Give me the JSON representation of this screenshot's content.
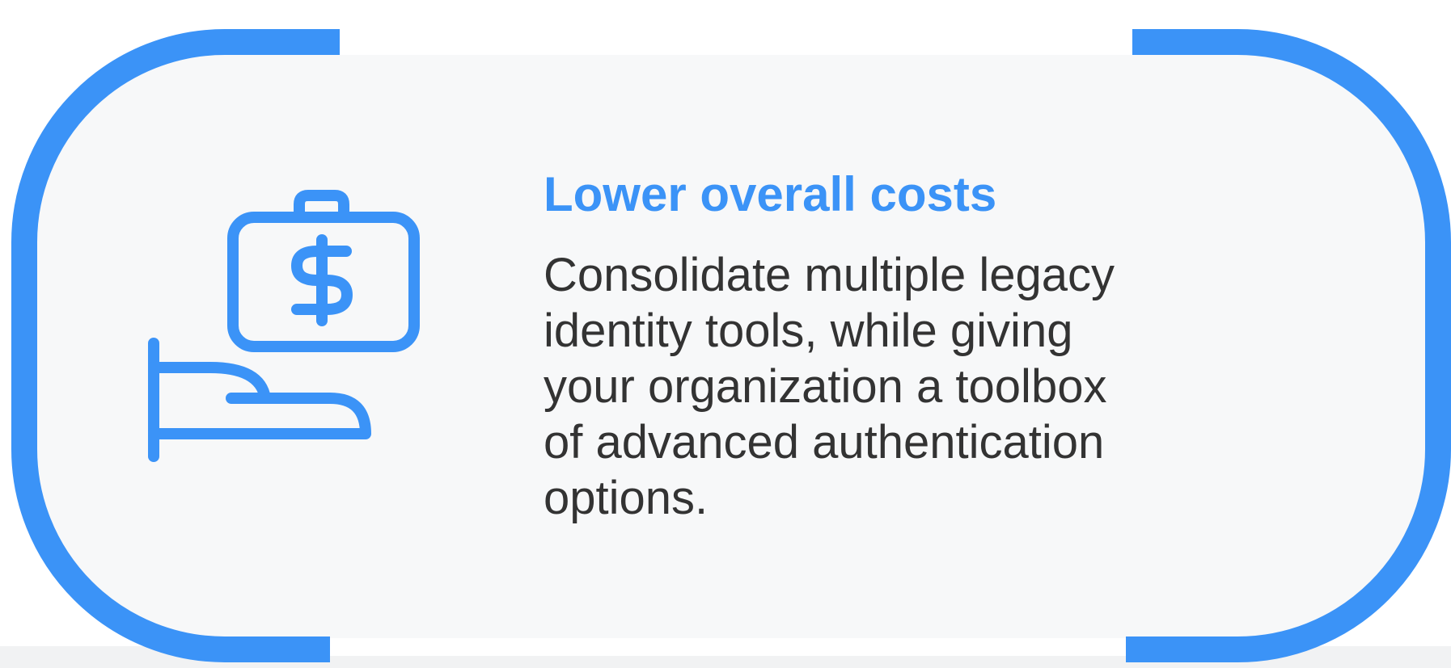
{
  "card": {
    "title": "Lower overall costs",
    "lines": [
      "Consolidate multiple legacy",
      "identity tools, while giving",
      "your organization a toolbox",
      "of advanced authentication",
      "options."
    ],
    "icon": "hand-holding-briefcase-dollar-icon"
  },
  "colors": {
    "accent": "#3b93f7",
    "text": "#333333",
    "card_background": "#f7f8f9",
    "page_background": "#ffffff"
  }
}
